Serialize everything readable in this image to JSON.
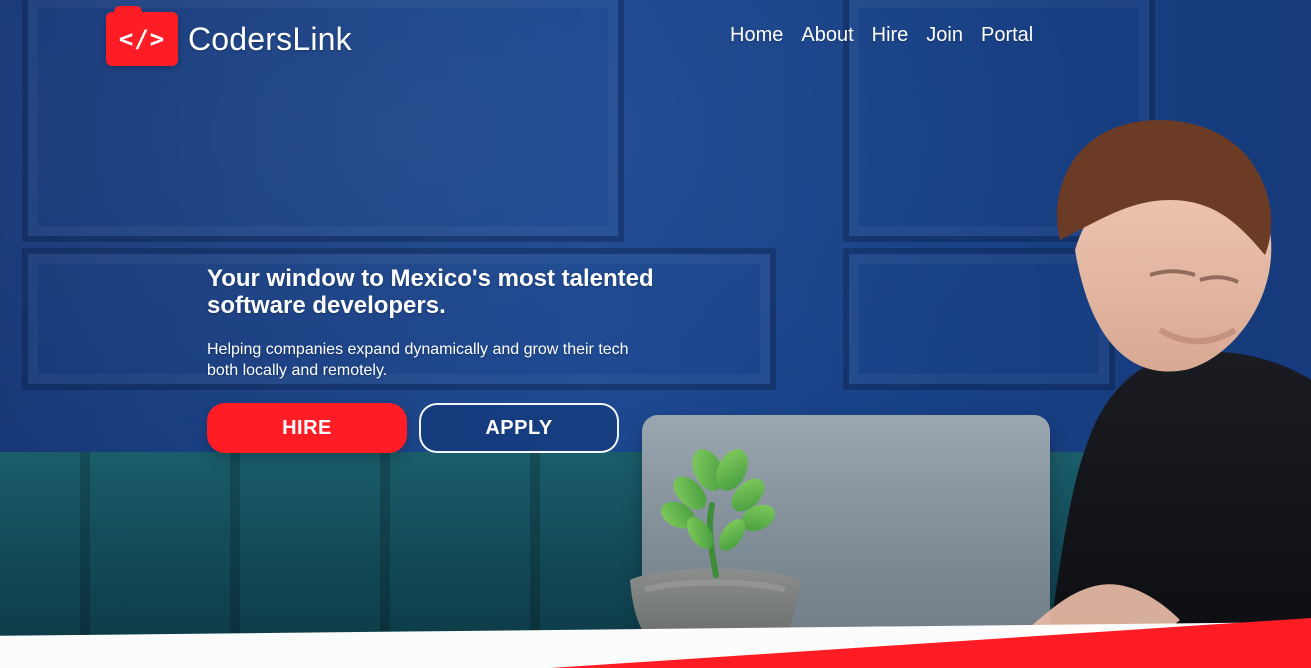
{
  "brand": {
    "logo_glyph": "</>",
    "name": "CodersLink",
    "colors": {
      "brand_red": "#ff1d25",
      "wall_blue": "#1a468f",
      "text_white": "#ffffff"
    }
  },
  "nav": {
    "items": [
      {
        "label": "Home"
      },
      {
        "label": "About"
      },
      {
        "label": "Hire"
      },
      {
        "label": "Join"
      },
      {
        "label": "Portal"
      }
    ]
  },
  "hero": {
    "title_line1": "Your window to Mexico's most talented",
    "title_line2": "software developers.",
    "subtitle_line1": "Helping companies expand dynamically and grow their tech",
    "subtitle_line2": "both locally and remotely."
  },
  "cta": {
    "hire_label": "HIRE",
    "apply_label": "APPLY"
  },
  "icons": {
    "logo_icon": "code-brackets-icon",
    "laptop_logo_icon": "apple-logo-icon"
  },
  "imagery": {
    "laptop_logo_glyph": ""
  }
}
